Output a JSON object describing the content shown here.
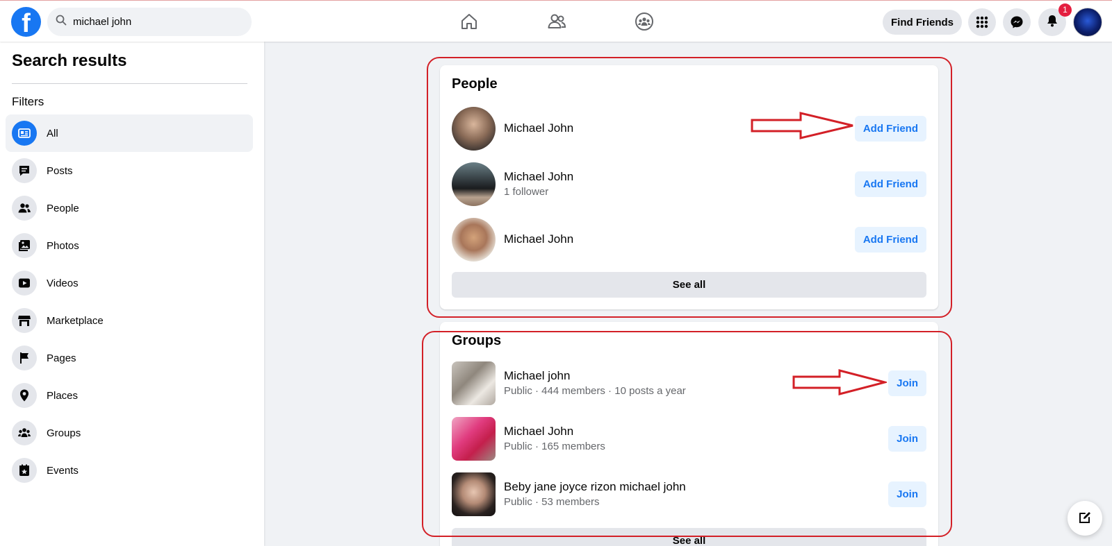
{
  "search": {
    "value": "michael john"
  },
  "header": {
    "find_friends_label": "Find Friends",
    "notification_count": "1",
    "logo_letter": "f",
    "brand_color": "#1877f2"
  },
  "sidebar": {
    "title": "Search results",
    "filters_label": "Filters",
    "items": [
      {
        "label": "All",
        "icon": "all-icon",
        "active": true
      },
      {
        "label": "Posts",
        "icon": "posts-icon"
      },
      {
        "label": "People",
        "icon": "people-icon"
      },
      {
        "label": "Photos",
        "icon": "photos-icon"
      },
      {
        "label": "Videos",
        "icon": "videos-icon"
      },
      {
        "label": "Marketplace",
        "icon": "marketplace-icon"
      },
      {
        "label": "Pages",
        "icon": "pages-icon"
      },
      {
        "label": "Places",
        "icon": "places-icon"
      },
      {
        "label": "Groups",
        "icon": "groups-icon"
      },
      {
        "label": "Events",
        "icon": "events-icon"
      }
    ]
  },
  "people": {
    "title": "People",
    "results": [
      {
        "name": "Michael John",
        "subtitle": "",
        "action": "Add Friend"
      },
      {
        "name": "Michael John",
        "subtitle": "1 follower",
        "action": "Add Friend"
      },
      {
        "name": "Michael John",
        "subtitle": "",
        "action": "Add Friend"
      }
    ],
    "see_all": "See all"
  },
  "groups": {
    "title": "Groups",
    "results": [
      {
        "name": "Michael john",
        "subtitle": "Public · 444 members · 10 posts a year",
        "action": "Join"
      },
      {
        "name": "Michael John",
        "subtitle": "Public · 165 members",
        "action": "Join"
      },
      {
        "name": "Beby jane joyce rizon michael john",
        "subtitle": "Public · 53 members",
        "action": "Join"
      }
    ],
    "see_all": "See all"
  },
  "annotation_color": "#d32027"
}
